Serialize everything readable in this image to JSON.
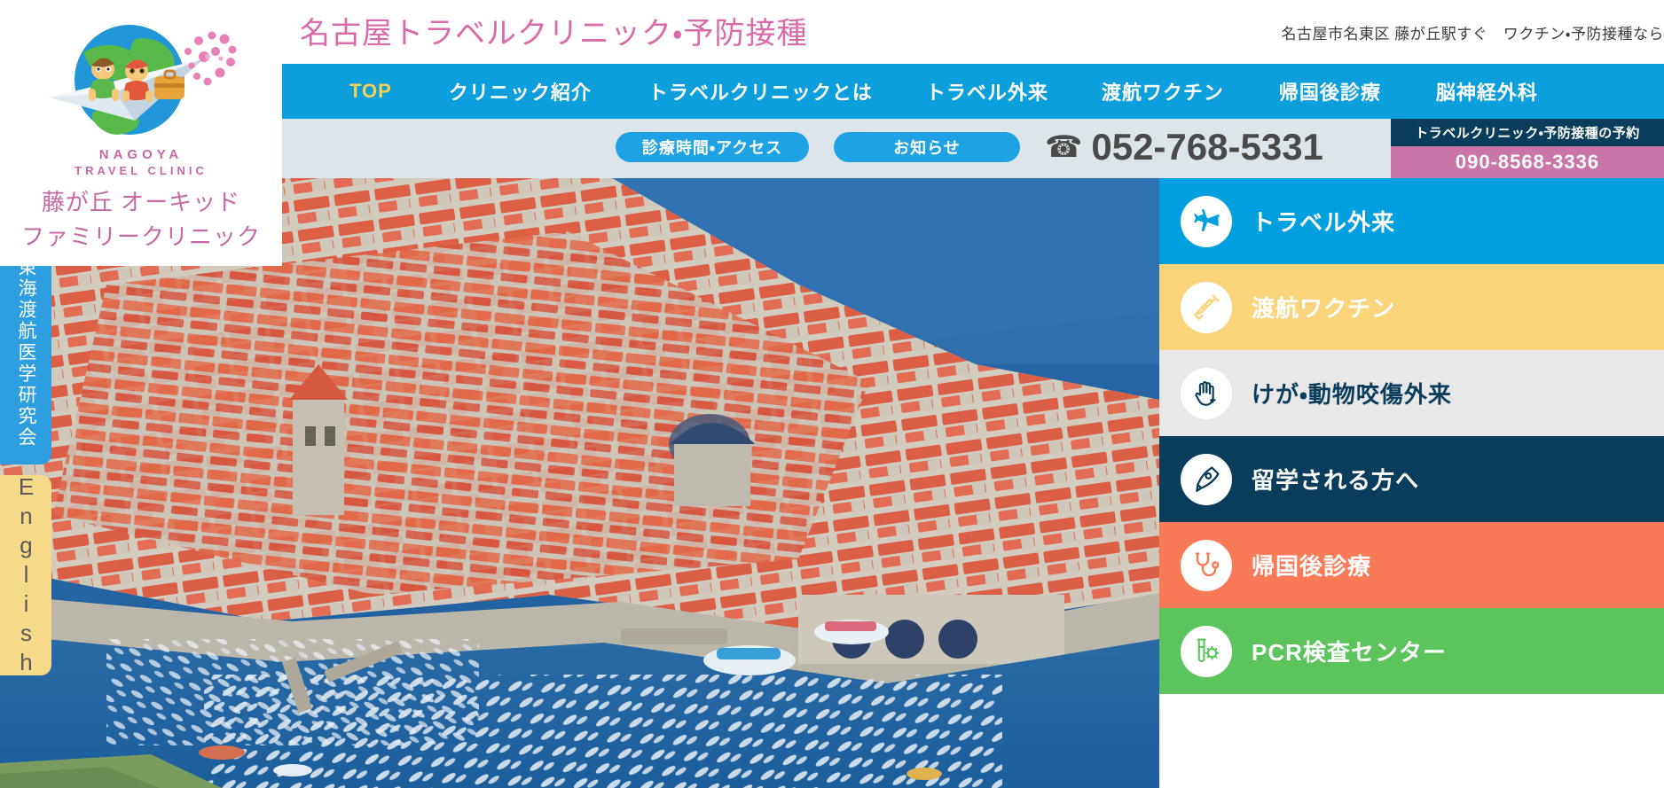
{
  "header": {
    "site_title": "名古屋トラベルクリニック・予防接種",
    "tagline": "名古屋市名東区 藤が丘駅すぐ　ワクチン・予防接種なら"
  },
  "logo": {
    "en_line1": "NAGOYA",
    "en_line2": "TRAVEL CLINIC",
    "jp_line1": "藤が丘 オーキッド",
    "jp_line2": "ファミリークリニック",
    "logo_icon": "paper-plane-globe-logo"
  },
  "nav": {
    "items": [
      {
        "label": "TOP",
        "active": true
      },
      {
        "label": "クリニック紹介",
        "active": false
      },
      {
        "label": "トラベルクリニックとは",
        "active": false
      },
      {
        "label": "トラベル外来",
        "active": false
      },
      {
        "label": "渡航ワクチン",
        "active": false
      },
      {
        "label": "帰国後診療",
        "active": false
      },
      {
        "label": "脳神経外科",
        "active": false
      }
    ]
  },
  "contact": {
    "hours_button": "診療時間・アクセス",
    "news_button": "お知らせ",
    "phone_icon": "telephone-icon",
    "phone_number": "052-768-5331",
    "reserve_heading": "トラベルクリニック・予防接種の予約",
    "reserve_number": "090-8568-3336"
  },
  "side_tabs": [
    {
      "label": "東海渡航医学研究会",
      "color": "#2d9fe0"
    },
    {
      "label": "English",
      "color": "#f7d98a"
    }
  ],
  "hero": {
    "alt": "ドブロヴニク旧市街の空撮写真"
  },
  "service_panels": [
    {
      "label": "トラベル外来",
      "icon": "airplane-icon",
      "bg": "#009fe0"
    },
    {
      "label": "渡航ワクチン",
      "icon": "syringe-icon",
      "bg": "#f9d47a"
    },
    {
      "label": "けが・動物咬傷外来",
      "icon": "hand-plus-icon",
      "bg": "#e8e8e8"
    },
    {
      "label": "留学される方へ",
      "icon": "pen-nib-icon",
      "bg": "#0a3d5c"
    },
    {
      "label": "帰国後診療",
      "icon": "stethoscope-icon",
      "bg": "#f97a56"
    },
    {
      "label": "PCR検査センター",
      "icon": "test-tube-virus-icon",
      "bg": "#5cc45c"
    }
  ]
}
